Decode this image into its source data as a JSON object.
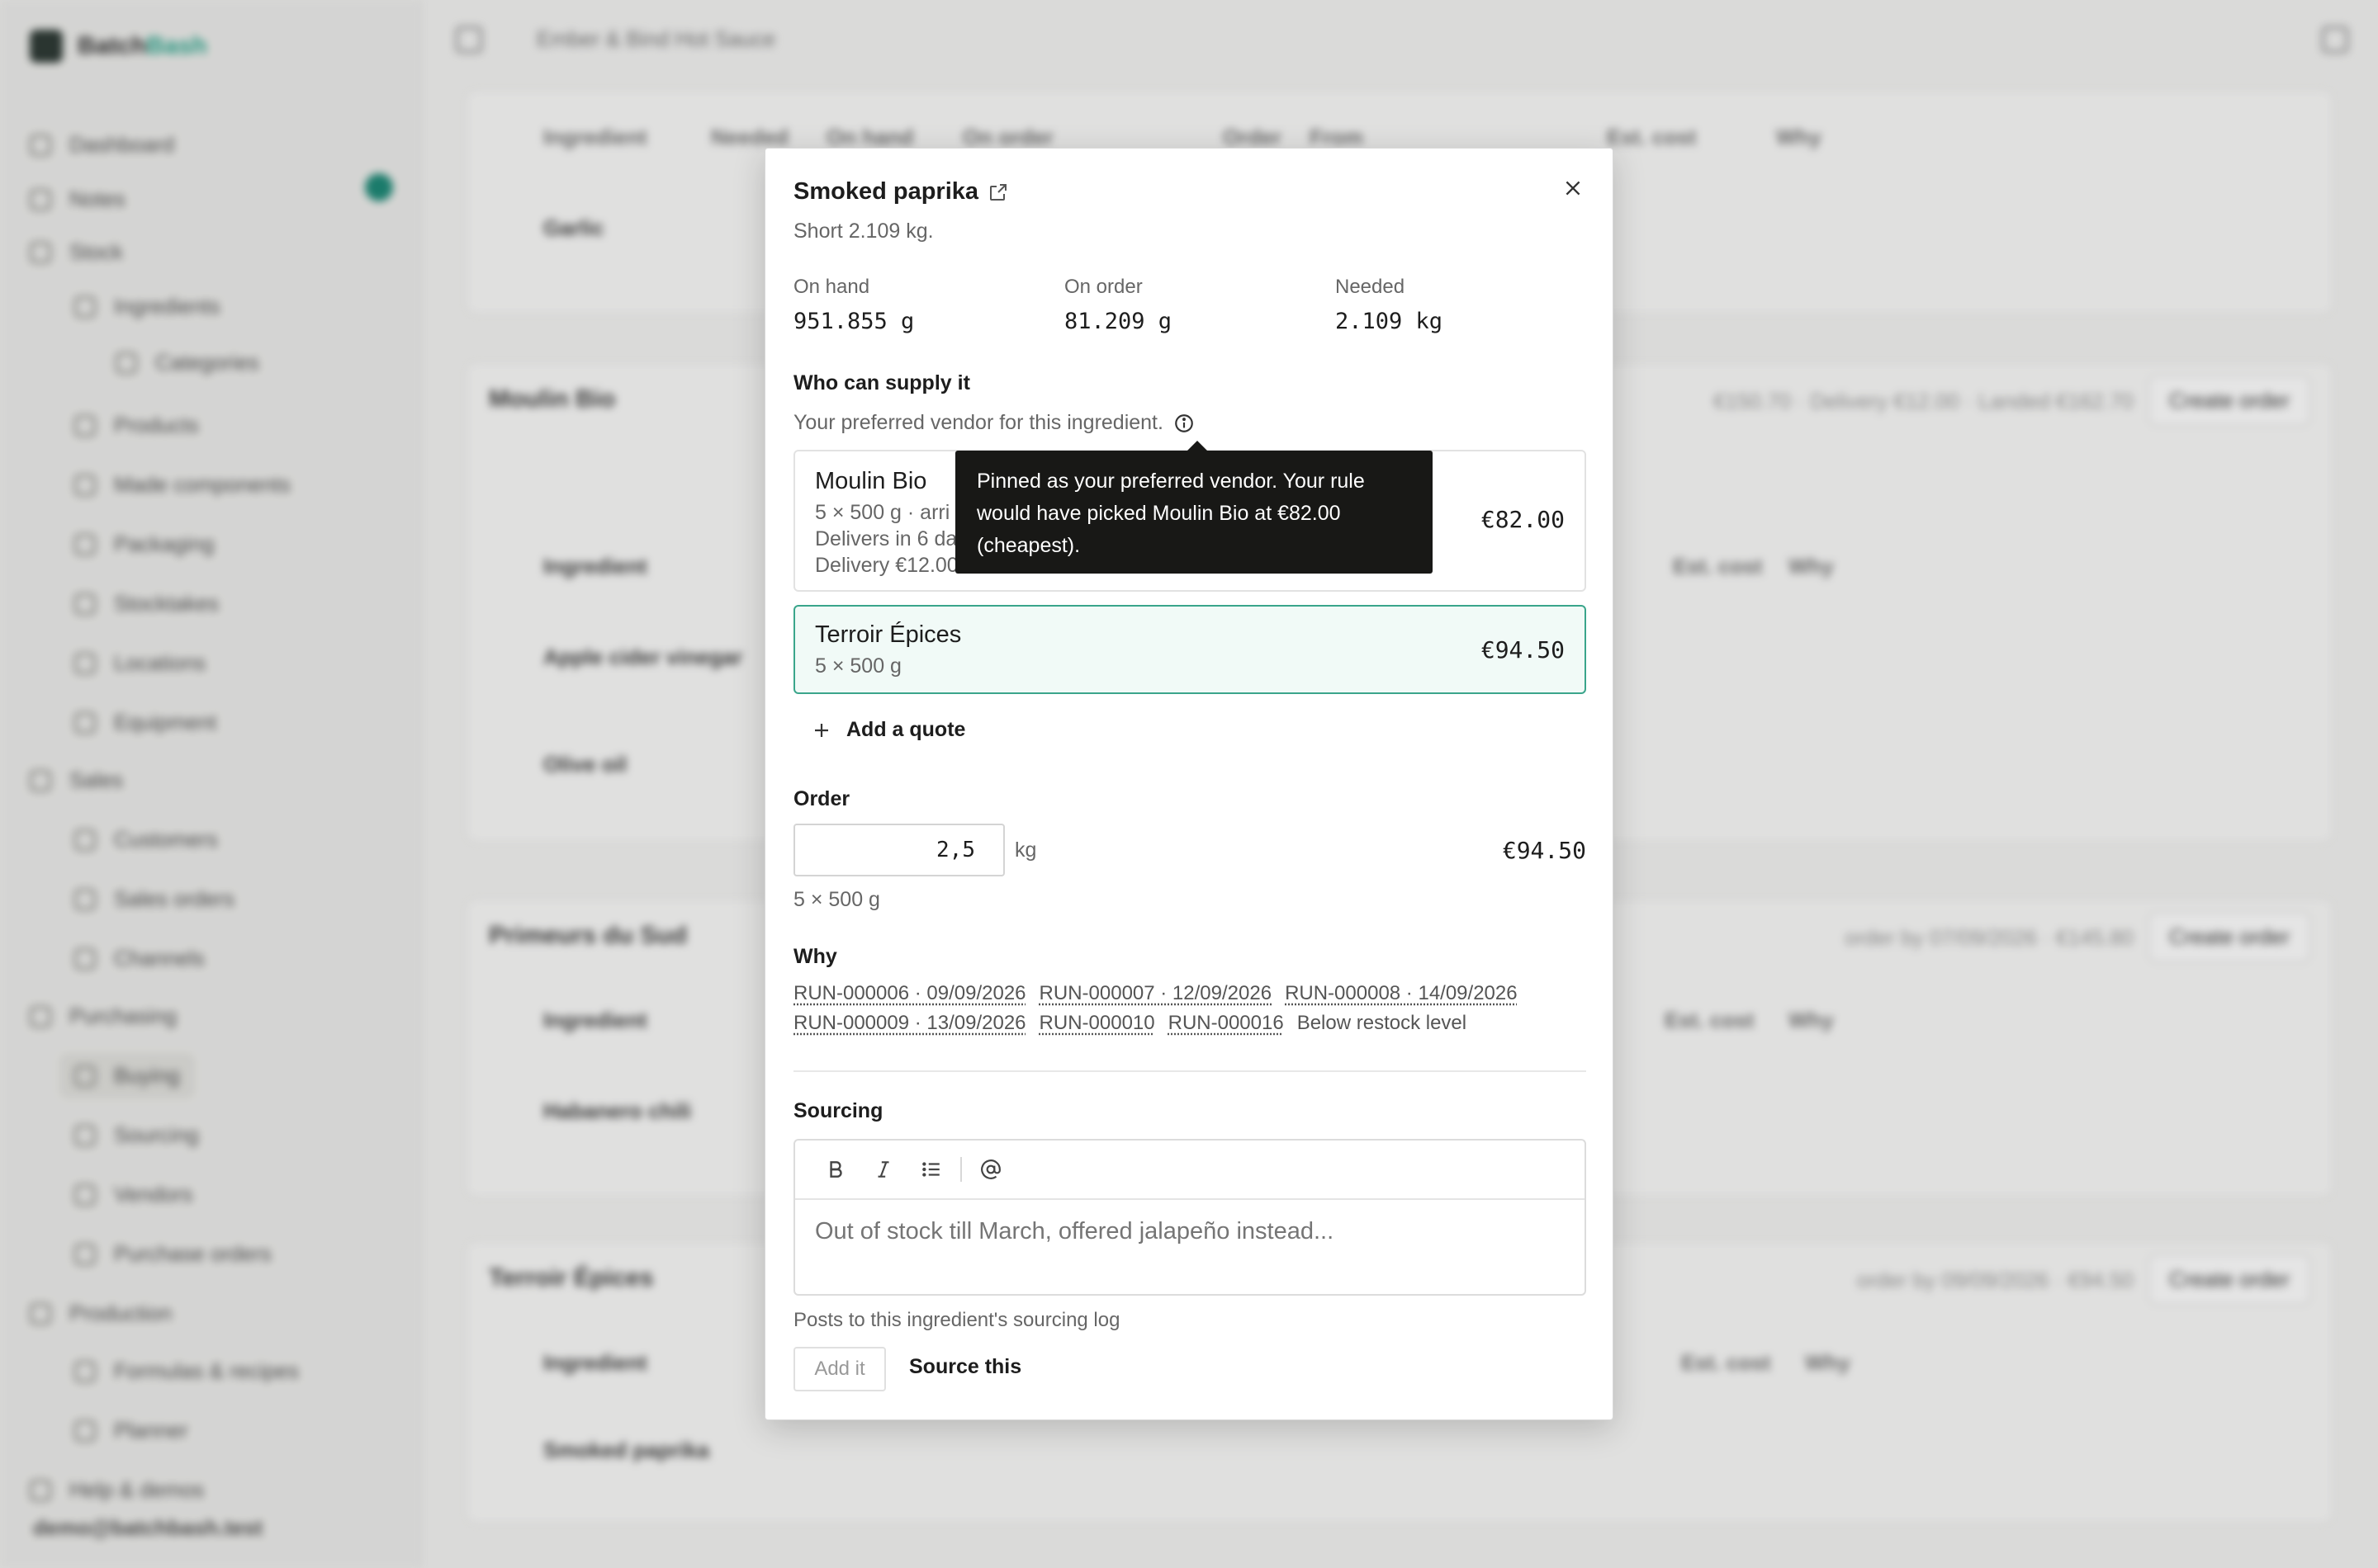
{
  "background": {
    "brand": {
      "name_main": "Batch",
      "name_accent": "Bash"
    },
    "breadcrumb": "Ember & Bind Hot Sauce",
    "nav": [
      "Dashboard",
      "Notes",
      "Stock",
      "Ingredients",
      "Categories",
      "Products",
      "Made components",
      "Packaging",
      "Stocktakes",
      "Locations",
      "Equipment",
      "Sales",
      "Customers",
      "Sales orders",
      "Channels",
      "Purchasing",
      "Buying",
      "Sourcing",
      "Vendors",
      "Purchase orders",
      "Production",
      "Formulas & recipes",
      "Planner",
      "Help & demos"
    ],
    "user_email": "demo@batchbash.test",
    "cards": [
      {
        "title": "",
        "meta": "",
        "button": ""
      },
      {
        "title": "Moulin Bio",
        "meta": "€150.70 · Delivery €12.00 · Landed €162.70",
        "button": "Create order"
      },
      {
        "title": "Primeurs du Sud",
        "meta": "order by 07/09/2026 · €145.80",
        "button": "Create order"
      },
      {
        "title": "Terroir Épices",
        "meta": "order by 09/09/2026 · €94.50",
        "button": "Create order"
      }
    ],
    "table_headers": [
      "Ingredient",
      "Needed",
      "On hand",
      "On order",
      "Order",
      "From",
      "Est. cost",
      "Why"
    ],
    "rows": [
      "Garlic",
      "Apple cider vinegar",
      "Olive oil",
      "Habanero chili",
      "Smoked paprika"
    ]
  },
  "modal": {
    "title": "Smoked paprika",
    "subtitle": "Short 2.109 kg.",
    "stats": [
      {
        "label": "On hand",
        "value": "951.855 g"
      },
      {
        "label": "On order",
        "value": "81.209 g"
      },
      {
        "label": "Needed",
        "value": "2.109 kg"
      }
    ],
    "supply": {
      "heading": "Who can supply it",
      "helper": "Your preferred vendor for this ingredient.",
      "tooltip": "Pinned as your preferred vendor. Your rule would have picked Moulin Bio at €82.00 (cheapest).",
      "vendors": [
        {
          "name": "Moulin Bio",
          "pack": "5 × 500 g · arri",
          "delivery_days": "Delivers in 6 da",
          "delivery_fee": "Delivery €12.00",
          "price": "€82.00"
        },
        {
          "name": "Terroir Épices",
          "pack": "5 × 500 g",
          "price": "€94.50"
        }
      ],
      "add_quote": "Add a quote"
    },
    "order": {
      "heading": "Order",
      "quantity": "2,5",
      "unit": "kg",
      "total": "€94.50",
      "pack_note": "5 × 500 g"
    },
    "why": {
      "heading": "Why",
      "row1": [
        "RUN-000006 · 09/09/2026",
        "RUN-000007 · 12/09/2026",
        "RUN-000008 · 14/09/2026"
      ],
      "row2": [
        "RUN-000009 · 13/09/2026",
        "RUN-000010",
        "RUN-000016"
      ],
      "reason": "Below restock level"
    },
    "sourcing": {
      "heading": "Sourcing",
      "placeholder": "Out of stock till March, offered jalapeño instead...",
      "posts_note": "Posts to this ingredient's sourcing log",
      "add_button": "Add it",
      "source_button": "Source this"
    }
  }
}
